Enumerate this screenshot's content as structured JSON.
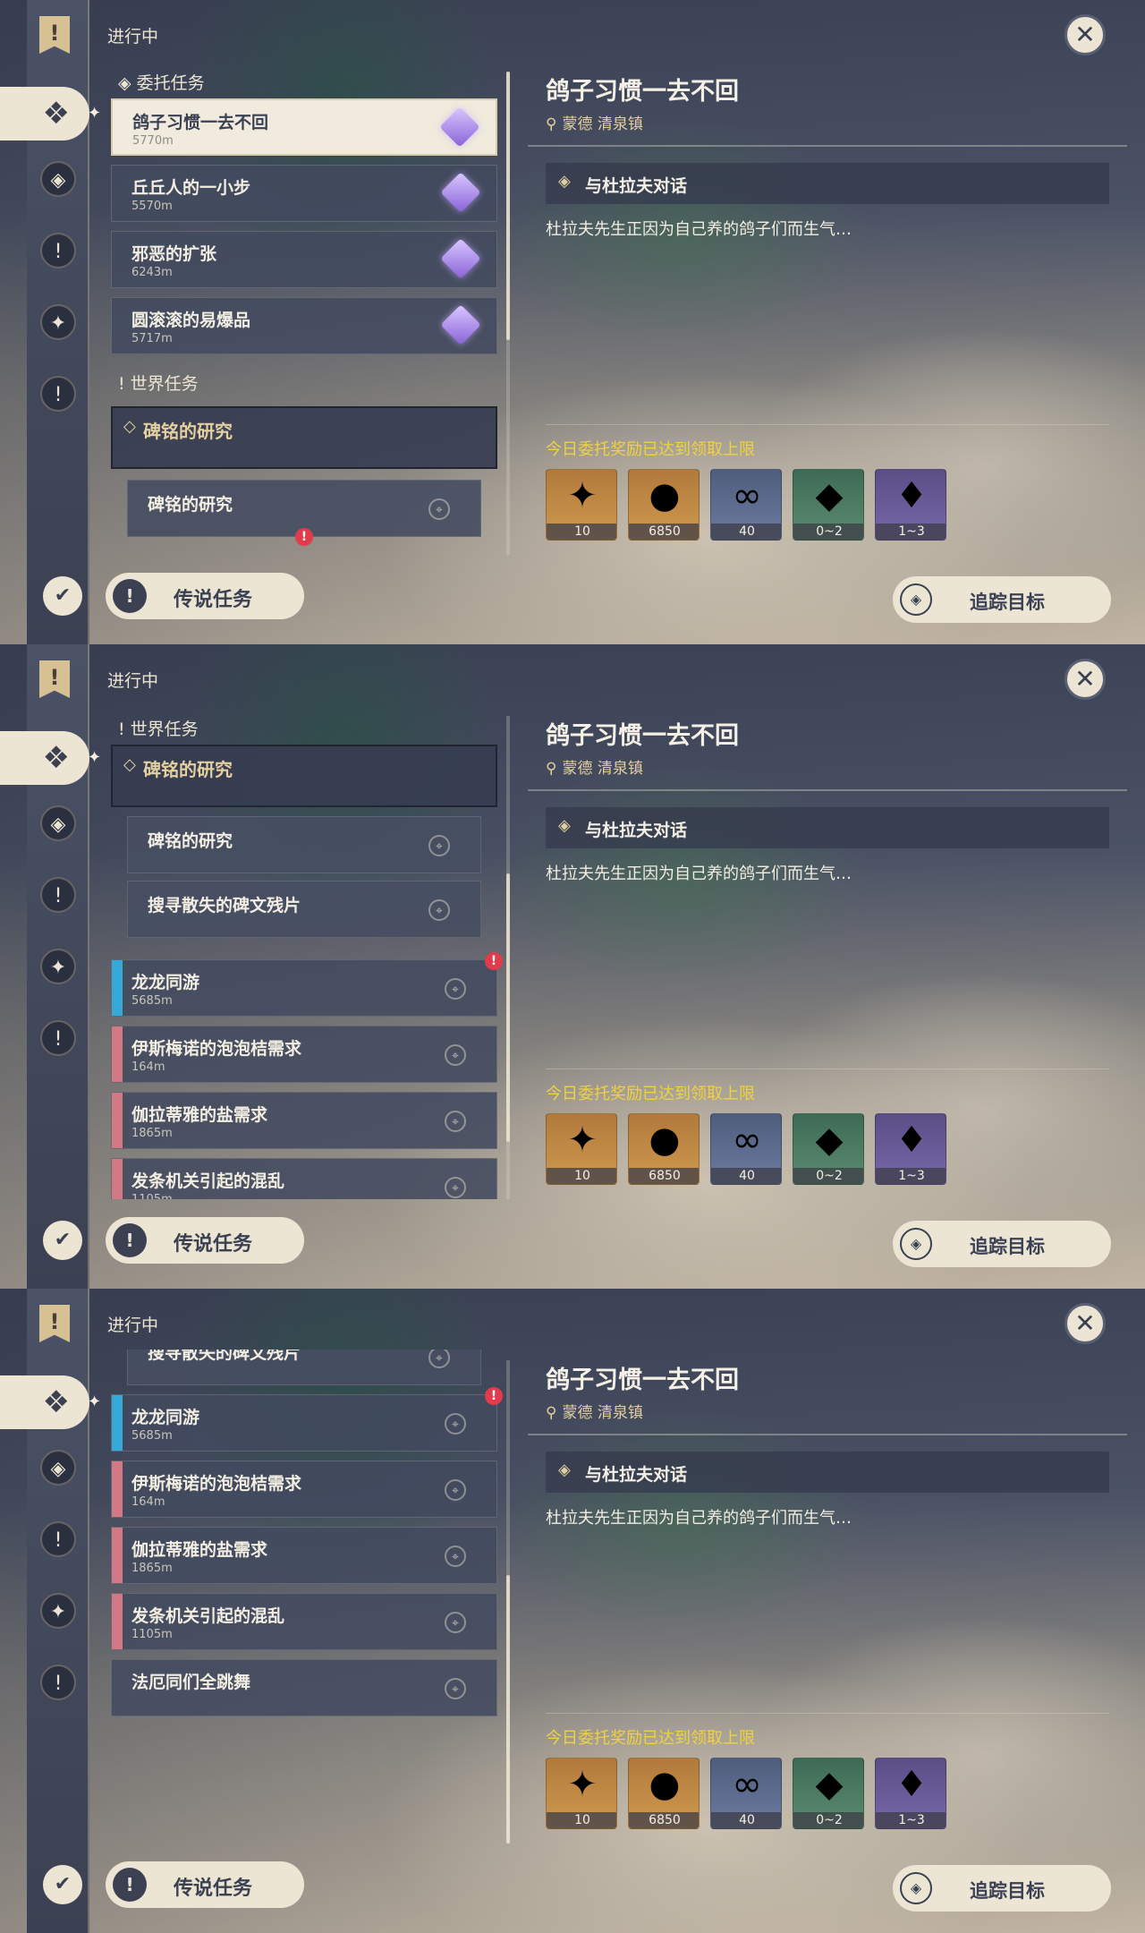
{
  "common": {
    "status": "进行中",
    "legend_button": "传说任务",
    "track_button": "追踪目标",
    "close_icon": "close-icon"
  },
  "detail": {
    "title": "鸽子习惯一去不回",
    "location": "蒙德 清泉镇",
    "objective": "与杜拉夫对话",
    "description": "杜拉夫先生正因为自己养的鸽子们而生气…",
    "reward_note": "今日委托奖励已达到领取上限",
    "rewards": [
      {
        "icon": "primogem-icon",
        "count": "10"
      },
      {
        "icon": "mora-icon",
        "count": "6850"
      },
      {
        "icon": "companionship-exp-icon",
        "count": "40"
      },
      {
        "icon": "crystal-icon",
        "count": "0~2"
      },
      {
        "icon": "crystal-cluster-icon",
        "count": "1~3"
      }
    ]
  },
  "commission": {
    "header": "委托任务",
    "items": [
      {
        "title": "鸽子习惯一去不回",
        "distance": "5770m"
      },
      {
        "title": "丘丘人的一小步",
        "distance": "5570m"
      },
      {
        "title": "邪恶的扩张",
        "distance": "6243m"
      },
      {
        "title": "圆滚滚的易爆品",
        "distance": "5717m"
      }
    ]
  },
  "world": {
    "header": "世界任务",
    "group_title": "碑铭的研究",
    "sub_items": [
      "碑铭的研究",
      "搜寻散失的碑文残片"
    ],
    "items": [
      {
        "title": "龙龙同游",
        "distance": "5685m"
      },
      {
        "title": "伊斯梅诺的泡泡桔需求",
        "distance": "164m"
      },
      {
        "title": "伽拉蒂雅的盐需求",
        "distance": "1865m"
      },
      {
        "title": "发条机关引起的混乱",
        "distance": "1105m"
      },
      {
        "title": "法厄同们全跳舞",
        "distance": ""
      }
    ]
  }
}
